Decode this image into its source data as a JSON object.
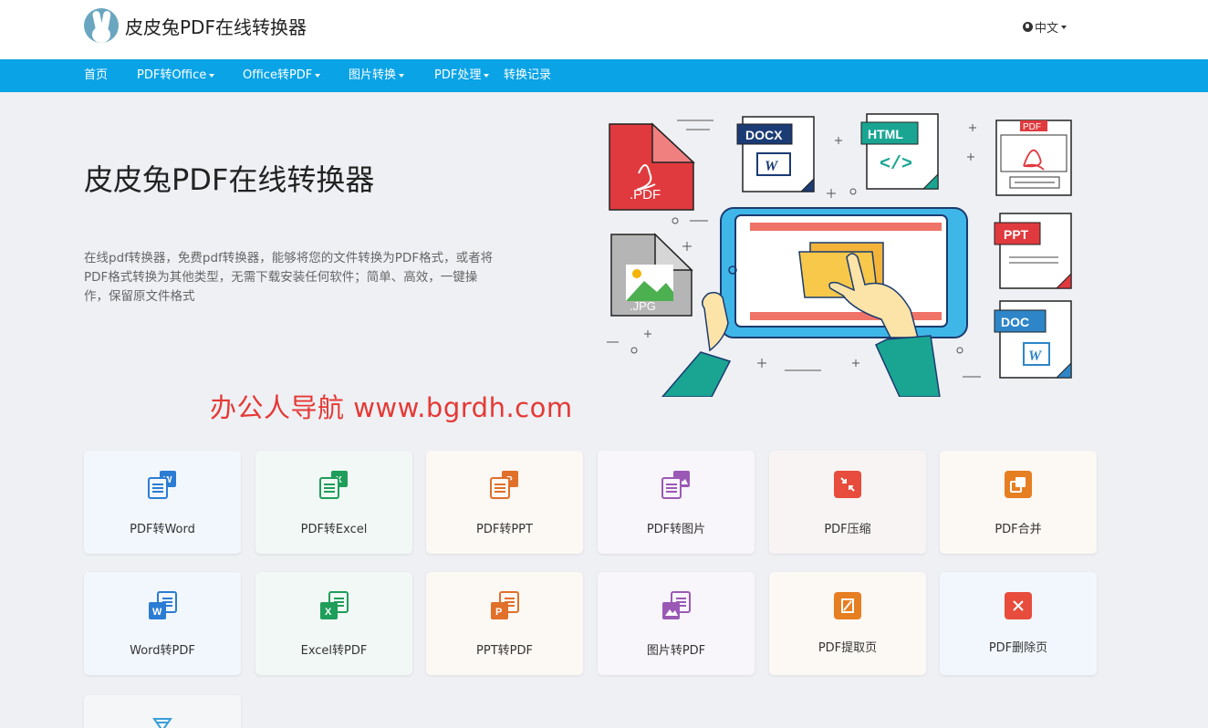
{
  "header": {
    "site_title": "皮皮兔PDF在线转换器",
    "language": "中文"
  },
  "nav": [
    {
      "label": "首页",
      "dropdown": false
    },
    {
      "label": "PDF转Office",
      "dropdown": true
    },
    {
      "label": "Office转PDF",
      "dropdown": true
    },
    {
      "label": "图片转换",
      "dropdown": true
    },
    {
      "label": "PDF处理",
      "dropdown": true
    },
    {
      "label": "转换记录",
      "dropdown": false
    }
  ],
  "hero": {
    "title": "皮皮兔PDF在线转换器",
    "description": "在线pdf转换器，免费pdf转换器，能够将您的文件转换为PDF格式，或者将PDF格式转换为其他类型，无需下载安装任何软件；简单、高效，一键操作，保留原文件格式",
    "illustration_labels": {
      "pdf": ".PDF",
      "docx": "DOCX",
      "html": "HTML",
      "pdf_small": "PDF",
      "ppt": "PPT",
      "jpg": ".JPG",
      "doc": "DOC"
    }
  },
  "watermark": "办公人导航  www.bgrdh.com",
  "tools": [
    {
      "label": "PDF转Word",
      "icon": "pdf-to-word-icon",
      "color": "#2b7cd3",
      "bg": "#f2f7fd"
    },
    {
      "label": "PDF转Excel",
      "icon": "pdf-to-excel-icon",
      "color": "#1e9e5a",
      "bg": "#f2f8f5"
    },
    {
      "label": "PDF转PPT",
      "icon": "pdf-to-ppt-icon",
      "color": "#e0702a",
      "bg": "#fcf8f4"
    },
    {
      "label": "PDF转图片",
      "icon": "pdf-to-image-icon",
      "color": "#9b59b6",
      "bg": "#f8f5fb"
    },
    {
      "label": "PDF压缩",
      "icon": "pdf-compress-icon",
      "color": "#e74c3c",
      "bg": "#f8f4f3"
    },
    {
      "label": "PDF合并",
      "icon": "pdf-merge-icon",
      "color": "#e67e22",
      "bg": "#fcf8f4"
    },
    {
      "label": "Word转PDF",
      "icon": "word-to-pdf-icon",
      "color": "#2b7cd3",
      "bg": "#f2f7fd"
    },
    {
      "label": "Excel转PDF",
      "icon": "excel-to-pdf-icon",
      "color": "#1e9e5a",
      "bg": "#f2f8f5"
    },
    {
      "label": "PPT转PDF",
      "icon": "ppt-to-pdf-icon",
      "color": "#e0702a",
      "bg": "#fcf8f4"
    },
    {
      "label": "图片转PDF",
      "icon": "image-to-pdf-icon",
      "color": "#9b59b6",
      "bg": "#f8f5fb"
    },
    {
      "label": "PDF提取页",
      "icon": "pdf-extract-icon",
      "color": "#e67e22",
      "bg": "#fcf8f4"
    },
    {
      "label": "PDF删除页",
      "icon": "pdf-delete-icon",
      "color": "#e74c3c",
      "bg": "#f2f7fd"
    },
    {
      "label": "",
      "icon": "filter-icon",
      "color": "#3aa0d8",
      "bg": "#f4f6f8"
    }
  ]
}
